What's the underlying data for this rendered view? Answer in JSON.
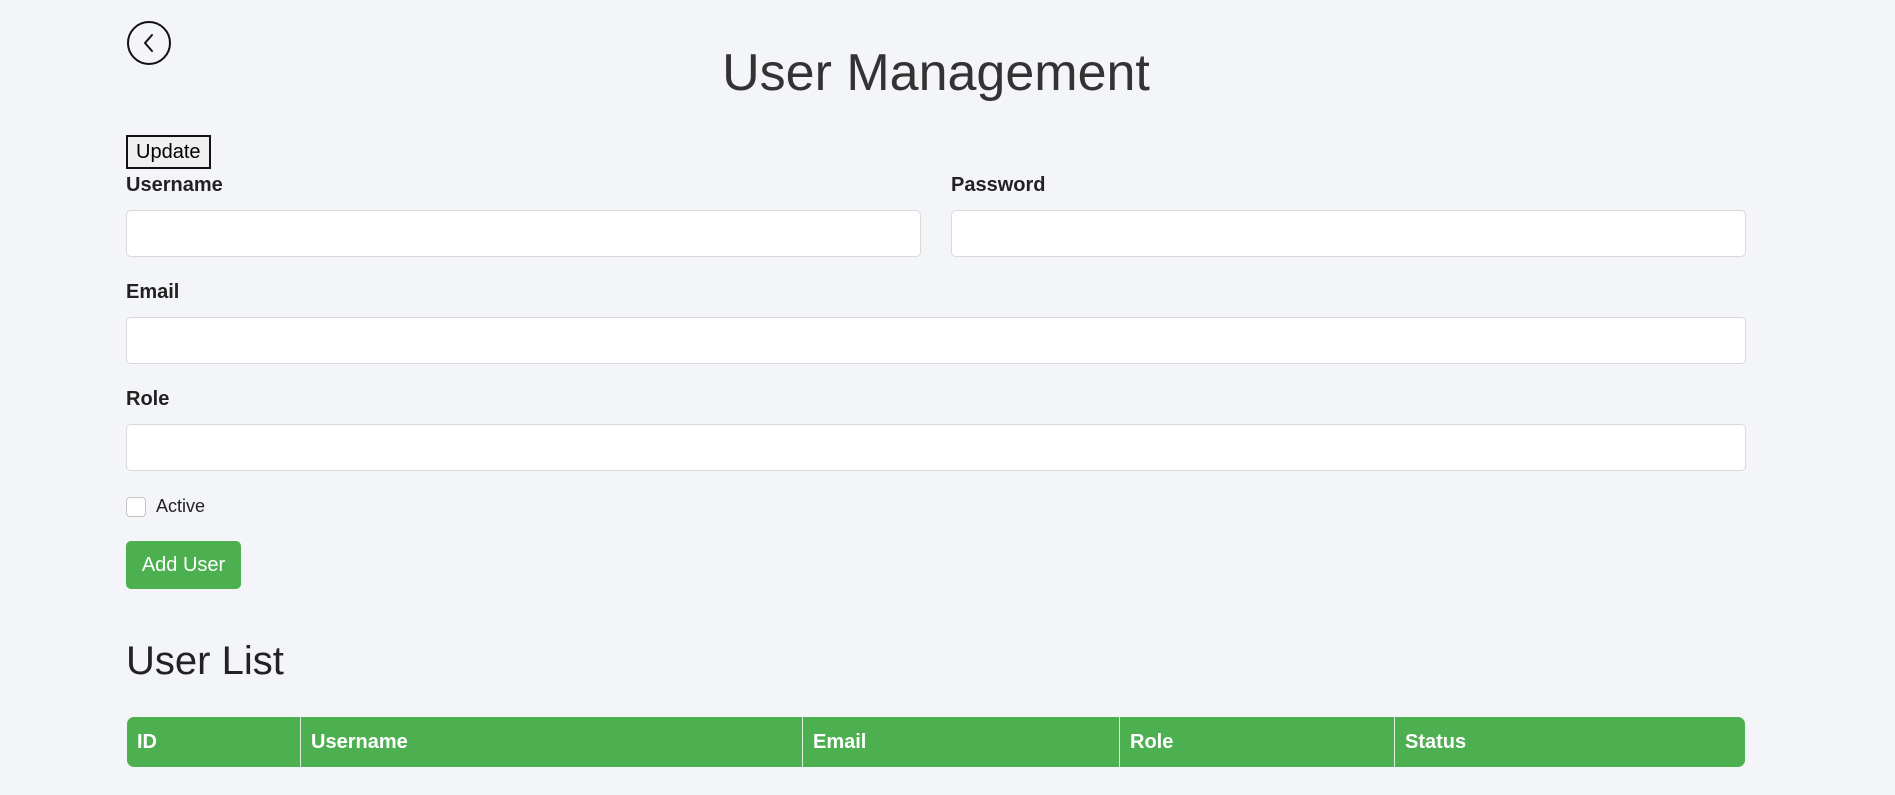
{
  "header": {
    "title": "User Management",
    "back_icon": "chevron-left-icon"
  },
  "toolbar": {
    "update_label": "Update"
  },
  "form": {
    "username": {
      "label": "Username",
      "value": "",
      "placeholder": ""
    },
    "password": {
      "label": "Password",
      "value": "",
      "placeholder": ""
    },
    "email": {
      "label": "Email",
      "value": "",
      "placeholder": ""
    },
    "role": {
      "label": "Role",
      "value": "",
      "placeholder": ""
    },
    "active": {
      "label": "Active",
      "checked": false
    },
    "submit_label": "Add User"
  },
  "user_list": {
    "title": "User List",
    "columns": [
      "ID",
      "Username",
      "Email",
      "Role",
      "Status"
    ],
    "rows": []
  },
  "colors": {
    "background": "#f4f5f9",
    "accent": "#4caf50"
  }
}
